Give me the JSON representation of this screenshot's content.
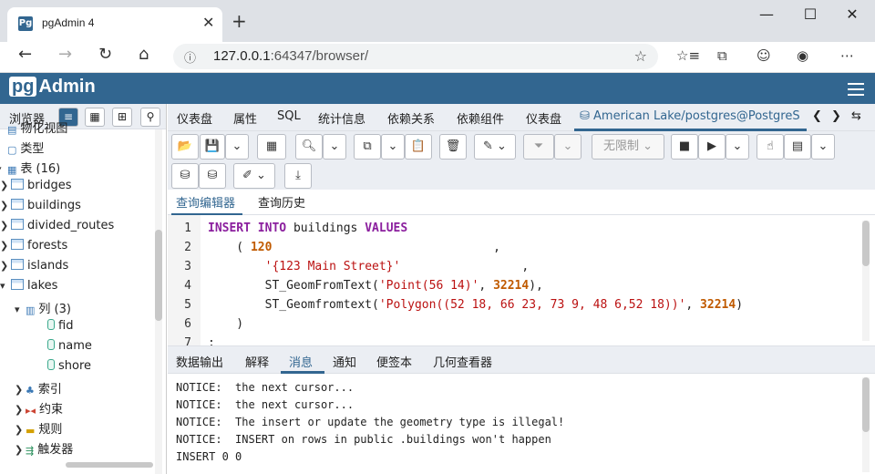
{
  "browser": {
    "tab_title": "pgAdmin 4",
    "favicon_text": "Pg",
    "url_host": "127.0.0.1",
    "url_port_path": ":64347/browser/"
  },
  "app": {
    "logo_pg": "pg",
    "logo_admin": "Admin",
    "brand_color": "#326690"
  },
  "left": {
    "browser_label": "浏览器",
    "tree": [
      {
        "label": "物化视图",
        "icon": "view-icon"
      },
      {
        "label": "类型",
        "icon": "type-icon"
      },
      {
        "label": "表 (16)",
        "icon": "tables-icon"
      },
      {
        "label": "bridges",
        "icon": "table-icon"
      },
      {
        "label": "buildings",
        "icon": "table-icon"
      },
      {
        "label": "divided_routes",
        "icon": "table-icon"
      },
      {
        "label": "forests",
        "icon": "table-icon"
      },
      {
        "label": "islands",
        "icon": "table-icon"
      },
      {
        "label": "lakes",
        "icon": "table-icon"
      },
      {
        "label": "列 (3)",
        "icon": "columns-icon"
      },
      {
        "label": "fid",
        "icon": "column-icon"
      },
      {
        "label": "name",
        "icon": "column-icon"
      },
      {
        "label": "shore",
        "icon": "column-icon"
      },
      {
        "label": "索引",
        "icon": "index-icon"
      },
      {
        "label": "约束",
        "icon": "constraint-icon"
      },
      {
        "label": "规则",
        "icon": "rule-icon"
      },
      {
        "label": "触发器",
        "icon": "trigger-icon"
      }
    ]
  },
  "tabs": {
    "items": [
      "仪表盘",
      "属性",
      "SQL",
      "统计信息",
      "依赖关系",
      "依赖组件",
      "仪表盘"
    ],
    "active": "American Lake/postgres@PostgreS"
  },
  "toolbar": {
    "limit_label": "无限制"
  },
  "editor": {
    "tabs": [
      "查询编辑器",
      "查询历史"
    ],
    "lines": [
      "1",
      "2",
      "3",
      "4",
      "5",
      "6",
      "7"
    ]
  },
  "output": {
    "tabs": [
      "数据输出",
      "解释",
      "消息",
      "通知",
      "便签本",
      "几何查看器"
    ],
    "messages": [
      "NOTICE:  the next cursor...",
      "NOTICE:  the next cursor...",
      "NOTICE:  The insert or update the geometry type is illegal!",
      "NOTICE:  INSERT on rows in public .buildings won't happen",
      "INSERT 0 0"
    ]
  }
}
